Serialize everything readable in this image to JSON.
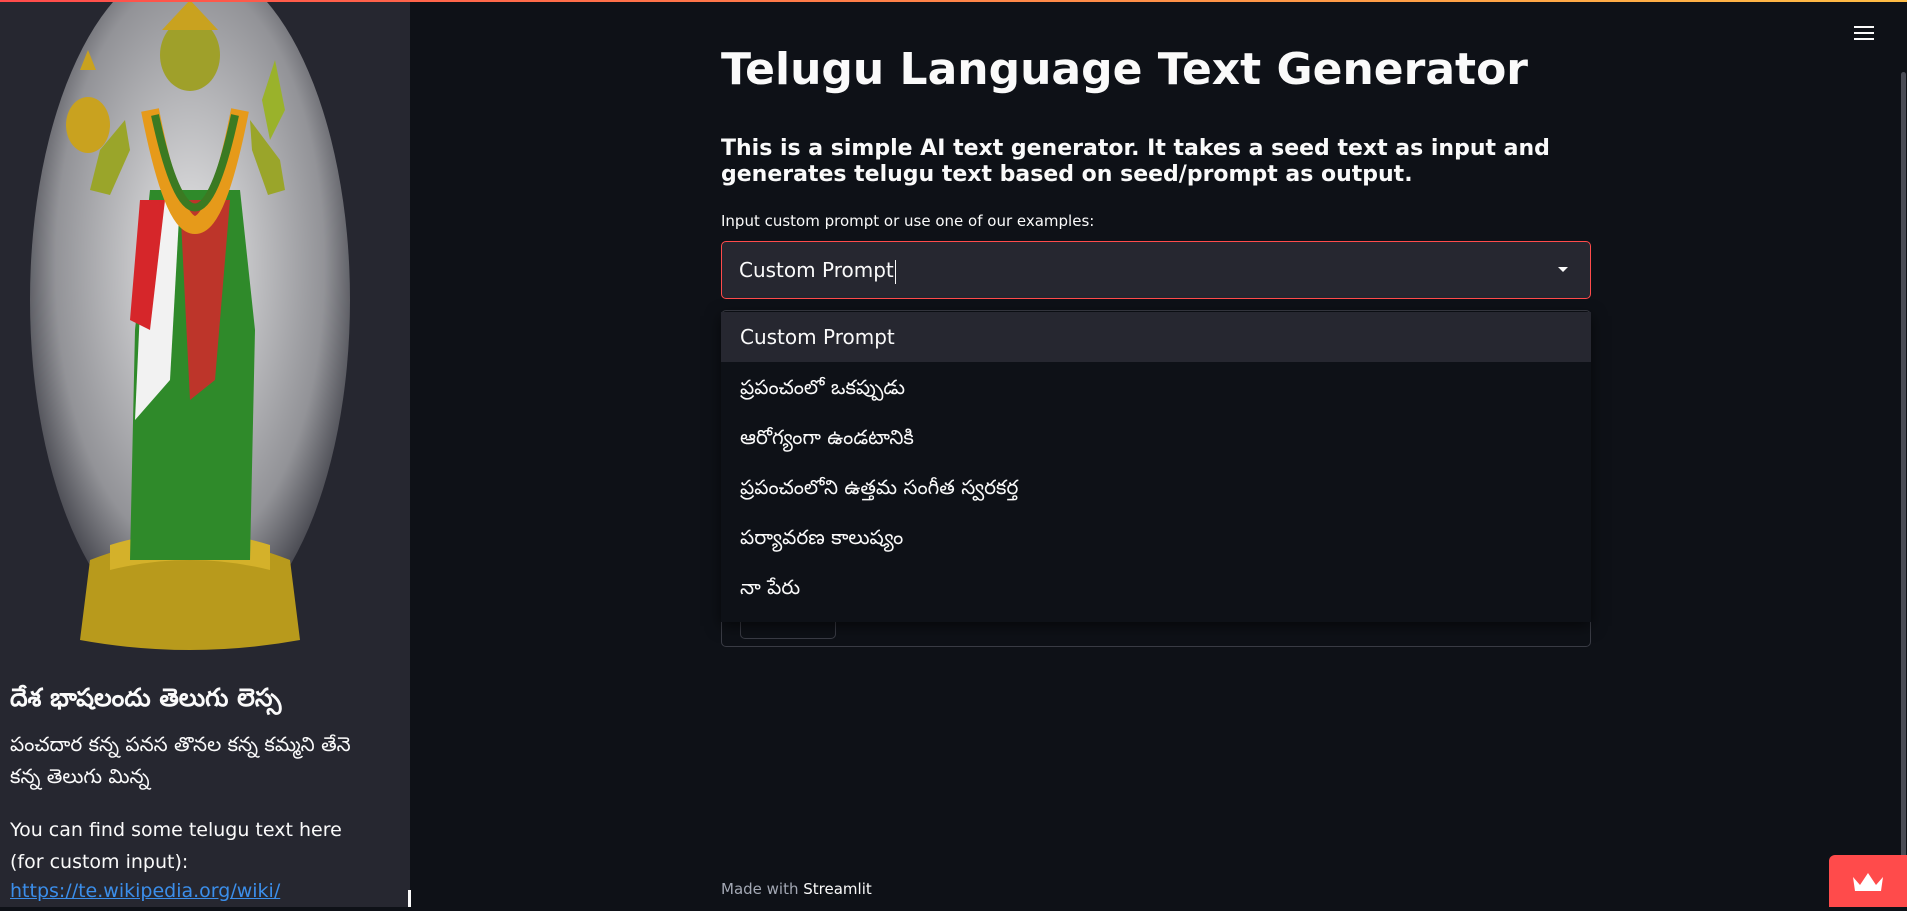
{
  "sidebar": {
    "heading": "దేశ భాషలందు తెలుగు లెస్స",
    "poem": "పంచదార కన్న పనస తొనల కన్న కమ్మని తేనె కన్న తెలుగు మిన్న",
    "info_text": "You can find some telugu text here (for custom input):",
    "link_text": "https://te.wikipedia.org/wiki/"
  },
  "main": {
    "title": "Telugu Language Text Generator",
    "subtitle": "This is a simple AI text generator. It takes a seed text as input and generates telugu text based on seed/prompt as output.",
    "select_label": "Input custom prompt or use one of our examples:",
    "select_value": "Custom Prompt",
    "options": [
      {
        "label": "Custom Prompt"
      },
      {
        "label": "ప్రపంచంలో ఒకప్పుడు"
      },
      {
        "label": "ఆరోగ్యంగా ఉండటానికి"
      },
      {
        "label": "ప్రపంచంలోని ఉత్తమ సంగీత స్వరకర్త"
      },
      {
        "label": "పర్యావరణ కాలుష్యం"
      },
      {
        "label": "నా పేరు"
      }
    ]
  },
  "footer": {
    "prefix": "Made with",
    "brand": "Streamlit"
  },
  "colors": {
    "background": "#0e1117",
    "sidebar": "#262730",
    "accent": "#ff4b4b",
    "link": "#3b8eea"
  },
  "icons": {
    "menu": "hamburger-icon",
    "dropdown": "chevron-down-icon",
    "badge": "crown-icon"
  }
}
